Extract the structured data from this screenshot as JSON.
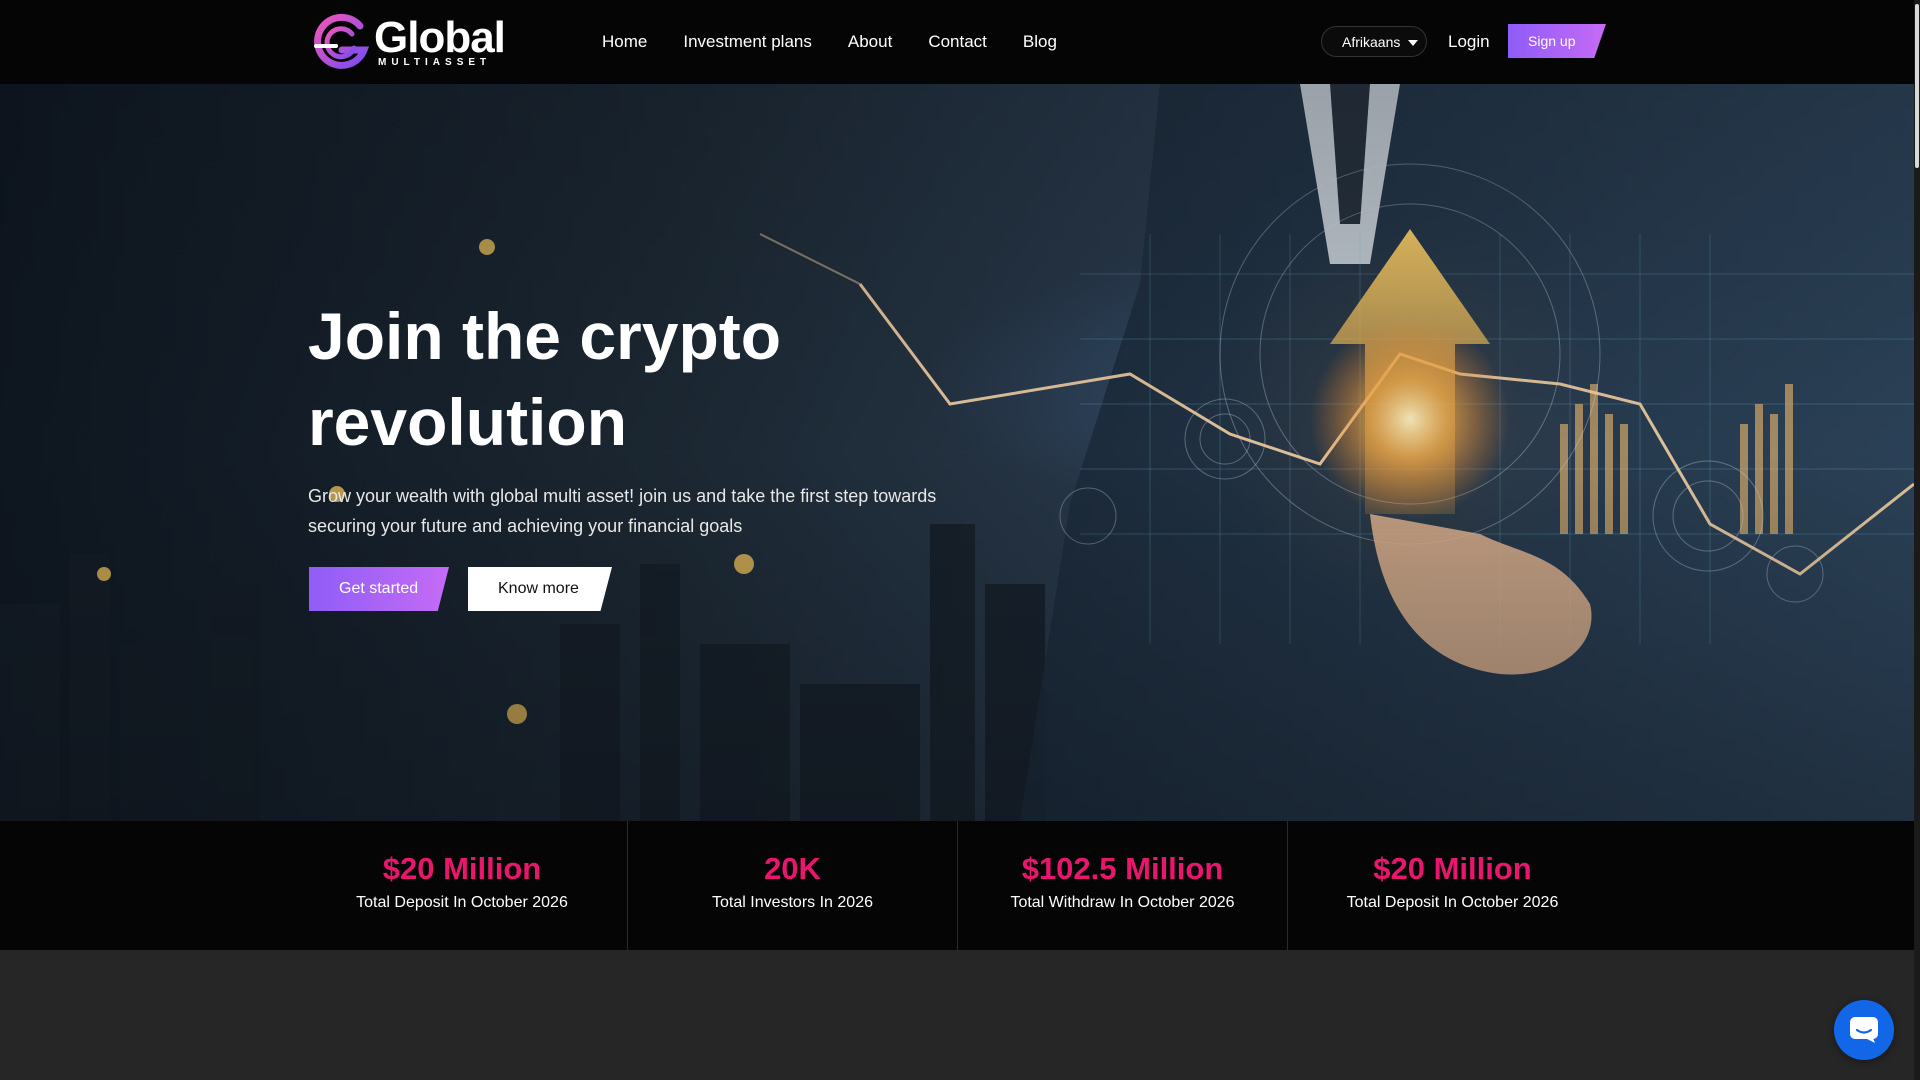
{
  "brand": {
    "name": "Global",
    "tagline": "MULTIASSET",
    "colors": {
      "accent_pink": "#e8176d",
      "gradient_start": "#8e5cf7",
      "gradient_end": "#c66bf6",
      "chat_blue": "#1167e8"
    }
  },
  "nav": {
    "links": [
      {
        "label": "Home"
      },
      {
        "label": "Investment plans"
      },
      {
        "label": "About"
      },
      {
        "label": "Contact"
      },
      {
        "label": "Blog"
      }
    ],
    "language": {
      "selected": "Afrikaans"
    },
    "login_label": "Login",
    "signup_label": "Sign up"
  },
  "hero": {
    "title": "Join the crypto revolution",
    "subtitle": "Grow your wealth with global multi asset! join us and take the first step towards securing your future and achieving your financial goals",
    "primary_cta": "Get started",
    "secondary_cta": "Know more"
  },
  "stats": [
    {
      "value": "$20 Million",
      "label": "Total Deposit In October 2026"
    },
    {
      "value": "20K",
      "label": "Total Investors In 2026"
    },
    {
      "value": "$102.5 Million",
      "label": "Total Withdraw In October 2026"
    },
    {
      "value": "$20 Million",
      "label": "Total Deposit In October 2026"
    }
  ],
  "icons": {
    "logo": "global-logo-icon",
    "language_caret": "chevron-down-icon",
    "chat": "chat-bubble-icon"
  }
}
